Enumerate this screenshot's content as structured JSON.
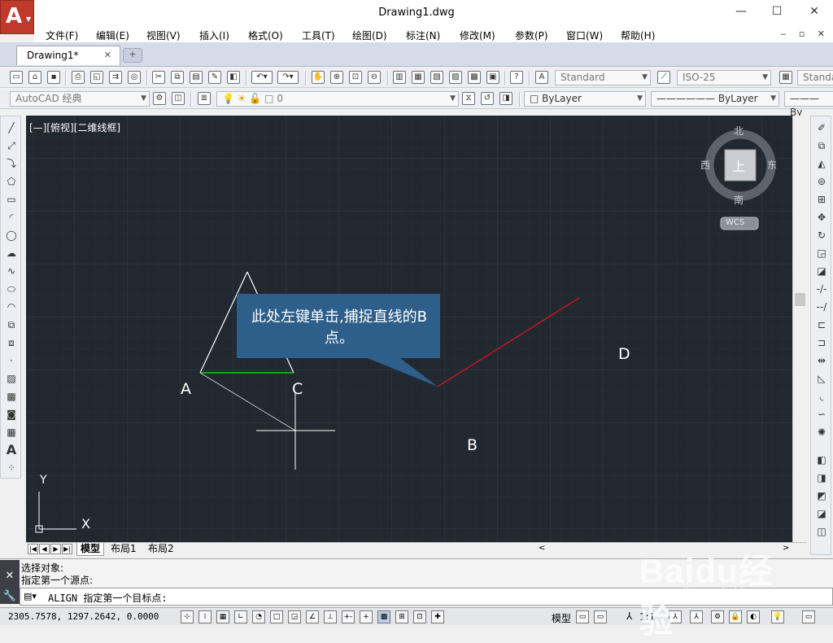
{
  "window": {
    "title": "Drawing1.dwg",
    "controls": [
      "—",
      "☐",
      "✕"
    ]
  },
  "menu": {
    "items": [
      "文件(F)",
      "编辑(E)",
      "视图(V)",
      "插入(I)",
      "格式(O)",
      "工具(T)",
      "绘图(D)",
      "标注(N)",
      "修改(M)",
      "参数(P)",
      "窗口(W)",
      "帮助(H)"
    ]
  },
  "tabs": {
    "document": "Drawing1*"
  },
  "toolbar": {
    "text_style": "Standard",
    "dim_style": "ISO-25",
    "table_style": "Standa",
    "workspace": "AutoCAD 经典",
    "layer": "0",
    "color": "ByLayer",
    "linetype": "ByLayer",
    "lineweight": "By"
  },
  "viewport": {
    "label": "[—][俯视][二维线框]",
    "viewcube_face": "上",
    "compass": {
      "north": "北",
      "south": "南",
      "east": "东",
      "west": "西"
    },
    "wcs": "WCS",
    "ucs_x": "X",
    "ucs_y": "Y"
  },
  "drawing": {
    "points": {
      "A": "A",
      "B": "B",
      "C": "C",
      "D": "D"
    },
    "callout": "此处左键单击,捕捉直线的B点。"
  },
  "layouts": {
    "tabs": [
      "模型",
      "布局1",
      "布局2"
    ]
  },
  "command": {
    "history": [
      "选择对象:",
      "指定第一个源点:"
    ],
    "prompt": "ALIGN 指定第一个目标点:"
  },
  "status": {
    "coords": "2305.7578, 1297.2642, 0.0000",
    "model": "模型",
    "scale": "1:1"
  },
  "watermark": {
    "brand": "Baidu经验",
    "url": "jingyan.baidu.com"
  },
  "colors": {
    "canvas": "#212830",
    "grid": "#2e3640",
    "red_line": "#c8141e",
    "green_line": "#22c422",
    "callout": "#2e5f8a"
  }
}
